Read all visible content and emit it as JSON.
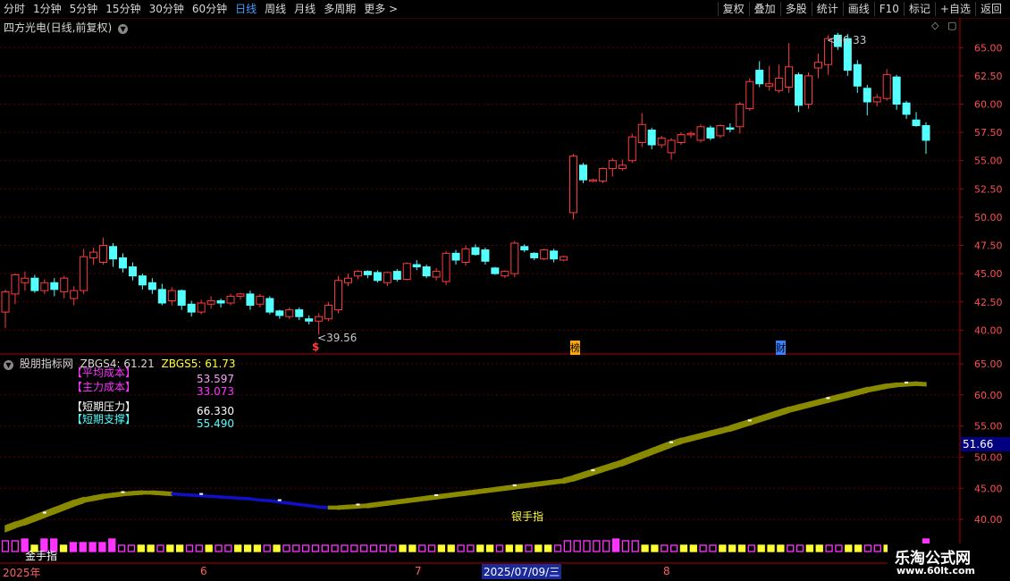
{
  "toolbar": {
    "periods": [
      "分时",
      "1分钟",
      "5分钟",
      "15分钟",
      "30分钟",
      "60分钟",
      "日线",
      "周线",
      "月线",
      "多周期",
      "更多 >"
    ],
    "active": "日线",
    "actions": [
      "复权",
      "叠加",
      "多股",
      "统计",
      "画线",
      "F10",
      "标记",
      "+自选",
      "返回"
    ]
  },
  "main_chart": {
    "title": "四方光电(日线,前复权)",
    "high_label": "66.33",
    "low_label": "39.56",
    "markers": [
      "$",
      "榜",
      "财"
    ],
    "y_ticks": [
      "65.00",
      "62.50",
      "60.00",
      "57.50",
      "55.00",
      "52.50",
      "50.00",
      "47.50",
      "45.00",
      "42.50",
      "40.00"
    ]
  },
  "indicator": {
    "name": "股朋指标网",
    "zbgs4_label": "ZBGS4:",
    "zbgs4": "61.21",
    "zbgs5_label": "ZBGS5:",
    "zbgs5": "61.73",
    "rows": [
      {
        "label": "【平均成本】",
        "value": "53.597"
      },
      {
        "label": "【主力成本】",
        "value": "33.073"
      },
      {
        "label": "【短期压力】",
        "value": "66.330"
      },
      {
        "label": "【短期支撑】",
        "value": "55.490"
      }
    ],
    "y_ticks": [
      "65.00",
      "60.00",
      "55.00",
      "50.00",
      "45.00",
      "40.00"
    ],
    "current": "51.66",
    "silver_label": "银手指",
    "gold_label": "金手指"
  },
  "time_axis": {
    "labels": [
      "2025年",
      "6",
      "7",
      "8"
    ],
    "selected": "2025/07/09/三"
  },
  "watermark": {
    "name": "乐淘公式网",
    "url": "www.60lt.com"
  },
  "colors": {
    "up": "#ff3b3b",
    "down": "#54ffff",
    "grid": "#5a0000",
    "axis": "#b00000",
    "ribbon": "#8a8a00",
    "blue": "#1010c8",
    "magenta": "#ff33ff",
    "yellow": "#ffff33"
  },
  "chart_data": {
    "type": "candlestick",
    "candles": [
      [
        41.6,
        43.4,
        40.2,
        43.6
      ],
      [
        43.2,
        44.9,
        42.3,
        45.0
      ],
      [
        44.2,
        44.6,
        43.5,
        45.2
      ],
      [
        44.6,
        43.5,
        43.3,
        44.9
      ],
      [
        43.5,
        44.2,
        43.2,
        44.5
      ],
      [
        44.2,
        43.6,
        43.0,
        44.6
      ],
      [
        43.4,
        44.6,
        42.8,
        44.8
      ],
      [
        42.8,
        43.5,
        42.2,
        43.9
      ],
      [
        43.5,
        46.5,
        43.2,
        47.2
      ],
      [
        46.4,
        46.9,
        45.8,
        47.3
      ],
      [
        46.0,
        47.5,
        45.8,
        48.2
      ],
      [
        47.4,
        46.3,
        45.6,
        47.7
      ],
      [
        46.4,
        45.5,
        45.1,
        46.8
      ],
      [
        45.6,
        44.8,
        44.4,
        46.0
      ],
      [
        44.8,
        44.0,
        43.6,
        45.0
      ],
      [
        44.2,
        43.6,
        43.2,
        44.6
      ],
      [
        43.6,
        42.4,
        42.2,
        44.1
      ],
      [
        42.6,
        43.5,
        42.2,
        43.8
      ],
      [
        43.5,
        42.2,
        41.8,
        43.6
      ],
      [
        42.3,
        41.6,
        41.2,
        42.6
      ],
      [
        41.6,
        42.4,
        41.4,
        42.7
      ],
      [
        42.3,
        42.6,
        41.9,
        43.0
      ],
      [
        42.6,
        42.4,
        42.0,
        42.8
      ],
      [
        42.4,
        43.0,
        42.2,
        43.2
      ],
      [
        43.0,
        43.2,
        42.7,
        43.3
      ],
      [
        43.2,
        42.2,
        41.8,
        43.5
      ],
      [
        42.3,
        43.0,
        42.0,
        43.2
      ],
      [
        42.8,
        41.6,
        41.4,
        43.0
      ],
      [
        41.7,
        41.3,
        41.0,
        41.8
      ],
      [
        41.2,
        41.8,
        41.0,
        42.0
      ],
      [
        41.8,
        41.2,
        40.9,
        42.0
      ],
      [
        41.0,
        40.8,
        40.5,
        41.3
      ],
      [
        40.8,
        41.2,
        39.6,
        41.5
      ],
      [
        41.0,
        42.2,
        40.8,
        42.5
      ],
      [
        41.8,
        44.4,
        41.5,
        44.8
      ],
      [
        44.2,
        44.6,
        43.9,
        45.0
      ],
      [
        44.8,
        45.2,
        44.5,
        45.3
      ],
      [
        45.2,
        44.9,
        44.6,
        45.3
      ],
      [
        45.1,
        44.4,
        44.2,
        45.3
      ],
      [
        44.2,
        45.1,
        43.9,
        45.2
      ],
      [
        45.2,
        44.5,
        44.3,
        45.4
      ],
      [
        44.5,
        45.9,
        44.4,
        46.0
      ],
      [
        45.8,
        45.6,
        45.3,
        46.2
      ],
      [
        45.6,
        44.8,
        44.6,
        45.8
      ],
      [
        44.7,
        45.2,
        44.4,
        45.5
      ],
      [
        44.3,
        46.8,
        44.0,
        47.0
      ],
      [
        46.8,
        46.2,
        45.8,
        47.1
      ],
      [
        46.0,
        47.2,
        45.7,
        47.5
      ],
      [
        47.3,
        46.7,
        46.6,
        47.6
      ],
      [
        47.1,
        46.1,
        45.8,
        47.3
      ],
      [
        45.5,
        45.0,
        44.9,
        45.6
      ],
      [
        44.8,
        45.2,
        44.6,
        45.3
      ],
      [
        45.0,
        47.7,
        44.7,
        47.9
      ],
      [
        47.4,
        47.1,
        46.9,
        47.6
      ],
      [
        46.8,
        46.4,
        46.2,
        46.9
      ],
      [
        46.3,
        47.1,
        46.2,
        47.2
      ],
      [
        47.0,
        46.3,
        46.0,
        47.2
      ],
      [
        46.2,
        46.5,
        46.1,
        46.6
      ],
      [
        50.4,
        55.4,
        49.8,
        55.6
      ],
      [
        54.6,
        53.3,
        53.0,
        54.8
      ],
      [
        53.2,
        53.3,
        53.1,
        53.4
      ],
      [
        53.2,
        54.3,
        53.0,
        54.4
      ],
      [
        54.3,
        55.0,
        53.6,
        55.2
      ],
      [
        54.3,
        54.6,
        54.1,
        55.1
      ],
      [
        55.0,
        57.1,
        54.8,
        57.4
      ],
      [
        56.6,
        58.2,
        56.2,
        59.2
      ],
      [
        57.7,
        56.4,
        56.0,
        57.9
      ],
      [
        56.4,
        57.0,
        56.1,
        57.2
      ],
      [
        55.7,
        56.8,
        55.1,
        57.0
      ],
      [
        56.6,
        57.3,
        56.4,
        57.5
      ],
      [
        57.4,
        57.4,
        57.0,
        57.6
      ],
      [
        56.8,
        58.0,
        56.6,
        58.2
      ],
      [
        57.9,
        57.0,
        56.8,
        58.1
      ],
      [
        57.2,
        58.1,
        57.0,
        58.2
      ],
      [
        57.9,
        57.8,
        57.5,
        58.3
      ],
      [
        58.0,
        60.0,
        57.4,
        60.2
      ],
      [
        59.6,
        62.0,
        59.4,
        62.3
      ],
      [
        63.0,
        61.8,
        61.5,
        63.8
      ],
      [
        61.6,
        61.8,
        61.2,
        63.4
      ],
      [
        61.2,
        62.3,
        61.0,
        63.5
      ],
      [
        61.5,
        63.3,
        61.0,
        65.4
      ],
      [
        62.6,
        59.9,
        59.3,
        62.8
      ],
      [
        60.0,
        62.5,
        59.6,
        62.8
      ],
      [
        63.2,
        63.7,
        62.3,
        64.5
      ],
      [
        63.5,
        65.8,
        62.6,
        66.1
      ],
      [
        66.1,
        65.1,
        64.8,
        66.3
      ],
      [
        65.8,
        63.0,
        62.5,
        66.2
      ],
      [
        63.5,
        61.6,
        61.0,
        63.9
      ],
      [
        61.4,
        60.2,
        59.0,
        61.7
      ],
      [
        60.2,
        60.6,
        59.8,
        60.9
      ],
      [
        60.5,
        62.6,
        60.3,
        63.1
      ],
      [
        62.4,
        60.0,
        59.5,
        62.6
      ],
      [
        60.1,
        59.1,
        58.7,
        60.3
      ],
      [
        58.6,
        58.1,
        58.0,
        59.3
      ],
      [
        58.1,
        56.8,
        55.6,
        58.4
      ]
    ],
    "indicator_line": [
      38.5,
      39.1,
      39.6,
      40.2,
      40.8,
      41.4,
      42.0,
      42.6,
      43.1,
      43.4,
      43.7,
      43.9,
      44.1,
      44.2,
      44.3,
      44.3,
      44.2,
      44.1,
      44.0,
      43.9,
      43.8,
      43.7,
      43.6,
      43.5,
      43.4,
      43.3,
      43.1,
      43.0,
      42.8,
      42.6,
      42.4,
      42.2,
      42.0,
      41.9,
      41.9,
      42.0,
      42.1,
      42.2,
      42.4,
      42.6,
      42.8,
      43.0,
      43.2,
      43.4,
      43.6,
      43.8,
      44.0,
      44.2,
      44.4,
      44.6,
      44.8,
      45.0,
      45.2,
      45.4,
      45.6,
      45.8,
      46.0,
      46.2,
      46.6,
      47.1,
      47.6,
      48.1,
      48.6,
      49.1,
      49.7,
      50.3,
      50.9,
      51.5,
      52.1,
      52.6,
      53.0,
      53.4,
      53.8,
      54.2,
      54.6,
      55.1,
      55.6,
      56.1,
      56.6,
      57.1,
      57.6,
      58.0,
      58.4,
      58.8,
      59.2,
      59.6,
      60.0,
      60.4,
      60.8,
      61.1,
      61.4,
      61.6,
      61.7,
      61.8,
      61.7
    ],
    "volume_types": [
      1,
      1,
      0,
      2,
      0,
      0,
      2,
      1,
      1,
      1,
      1,
      0,
      3,
      3,
      2,
      2,
      3,
      2,
      2,
      3,
      3,
      2,
      3,
      3,
      2,
      2,
      2,
      3,
      2,
      3,
      3,
      3,
      3,
      3,
      3,
      3,
      3,
      3,
      3,
      3,
      3,
      2,
      2,
      3,
      3,
      2,
      2,
      3,
      3,
      2,
      2,
      3,
      2,
      2,
      3,
      2,
      2,
      3,
      1,
      1,
      1,
      1,
      1,
      0,
      1,
      1,
      2,
      2,
      3,
      3,
      2,
      2,
      3,
      3,
      2,
      2,
      2,
      3,
      2,
      2,
      2,
      3,
      3,
      2,
      2,
      3,
      3,
      2,
      2,
      3,
      3,
      2,
      2,
      3,
      3,
      0
    ],
    "main_ylim": [
      39.0,
      67.0
    ],
    "indicator_ylim": [
      38.0,
      66.0
    ]
  }
}
